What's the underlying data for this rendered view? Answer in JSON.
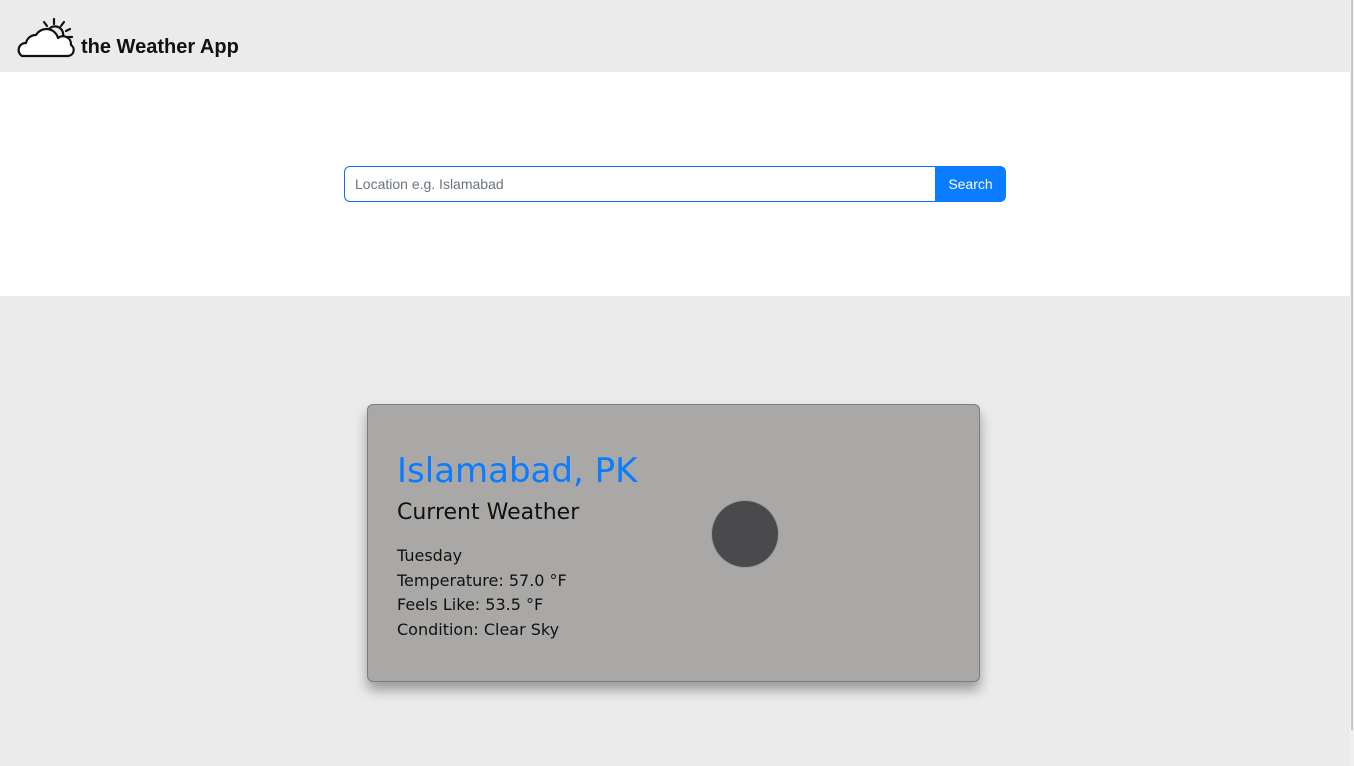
{
  "app": {
    "title": "the Weather App",
    "logo_icon": "cloud-sun-icon"
  },
  "search": {
    "placeholder": "Location e.g. Islamabad",
    "value": "",
    "button_label": "Search"
  },
  "weather": {
    "city": "Islamabad, PK",
    "heading": "Current Weather",
    "day": "Tuesday",
    "temperature": "Temperature: 57.0 °F",
    "feels_like": "Feels Like: 53.5 °F",
    "condition": "Condition: Clear Sky",
    "icon": "weather-condition-icon"
  },
  "colors": {
    "accent": "#0a7cff",
    "card_background": "#a9a8a7",
    "page_background": "#ebebeb"
  }
}
